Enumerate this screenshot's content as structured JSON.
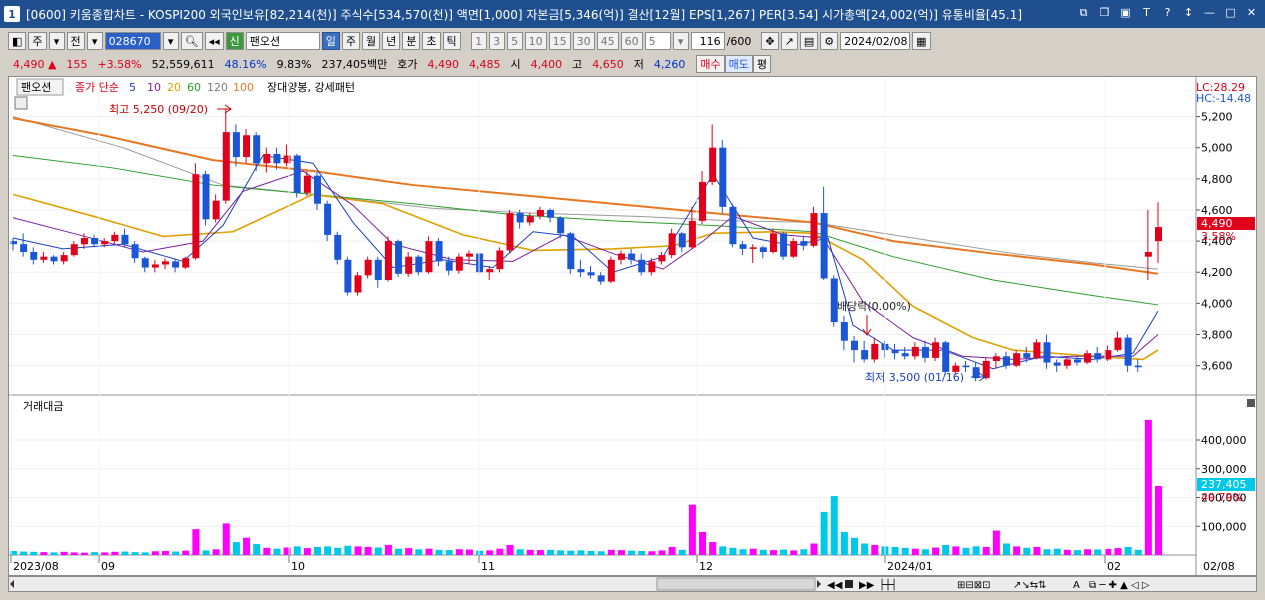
{
  "window": {
    "number": "1",
    "title": "[0600] 키움종합차트 - KOSPI200 외국인보유[82,214(천)] 주식수[534,570(천)] 액면[1,000] 자본금[5,346(억)] 결산[12월] EPS[1,267] PER[3.54] 시가총액[24,002(억)] 유통비율[45.1]"
  },
  "toolbar": {
    "period_main": "주",
    "prev_label": "전",
    "stock_code": "028670",
    "new_badge": "신",
    "stock_name": "팬오션",
    "periods": [
      "일",
      "주",
      "월",
      "년",
      "분",
      "초",
      "틱"
    ],
    "selected_period": "일",
    "intervals": [
      "1",
      "3",
      "5",
      "10",
      "15",
      "30",
      "45",
      "60"
    ],
    "interval_value": "5",
    "count": "116",
    "count_total": "/600",
    "date": "2024/02/08"
  },
  "quote": {
    "price": "4,490",
    "arrow": "▲",
    "change": "155",
    "change_pct": "+3.58%",
    "volume": "52,559,611",
    "vol_ratio": "48.16%",
    "turnover": "9.83%",
    "amount": "237,405백만",
    "bid_label": "호가",
    "bid1": "4,490",
    "bid2": "4,485",
    "open_label": "시",
    "open": "4,400",
    "high_label": "고",
    "high": "4,650",
    "low_label": "저",
    "low": "4,260",
    "buy_label": "매수",
    "sell_label": "매도",
    "eval_label": "평"
  },
  "legend": {
    "stock_name": "팬오션",
    "ma_title": "종가 단순",
    "ma_periods": [
      "5",
      "10",
      "20",
      "60",
      "120",
      "100"
    ],
    "ma_colors": [
      "#1a3fc4",
      "#7b1fa2",
      "#e0a000",
      "#2e9e2e",
      "#7f7f7f",
      "#e87722"
    ],
    "pattern_label": "장대양봉, 강세패턴",
    "lc_label": "LC:28.29",
    "hc_label": "HC:-14.48",
    "volume_title": "거래대금"
  },
  "annotations": {
    "high_marker": "최고 5,250 (09/20)",
    "low_marker": "최저 3,500 (01/16)",
    "ex_marker": "배당락(0.00%)"
  },
  "price_axis": {
    "ticks": [
      "5,200",
      "5,000",
      "4,800",
      "4,600",
      "4,400",
      "4,200",
      "4,000",
      "3,800",
      "3,600"
    ],
    "current": "4,490",
    "current_pct": "3.58%"
  },
  "volume_axis": {
    "ticks": [
      "400,000",
      "300,000",
      "200,000",
      "100,000"
    ],
    "current": "237,405",
    "current_pct": "49.79%"
  },
  "x_axis": [
    "2023/08",
    "09",
    "10",
    "11",
    "12",
    "2024/01",
    "02",
    "02/08"
  ],
  "colors": {
    "up": "#e0001b",
    "down": "#1a56d6",
    "vol_up": "#ff00ff",
    "vol_down": "#00c8e8",
    "title_bg": "#1f4f8f"
  },
  "chart_data": {
    "type": "candlestick",
    "price_ylim": [
      3450,
      5300
    ],
    "volume_ylim": [
      0,
      480000
    ],
    "candles": [
      [
        4400,
        4420,
        4340,
        4380
      ],
      [
        4380,
        4450,
        4300,
        4330
      ],
      [
        4330,
        4360,
        4250,
        4280
      ],
      [
        4280,
        4330,
        4260,
        4300
      ],
      [
        4300,
        4310,
        4250,
        4270
      ],
      [
        4270,
        4330,
        4250,
        4310
      ],
      [
        4310,
        4400,
        4300,
        4380
      ],
      [
        4380,
        4450,
        4350,
        4420
      ],
      [
        4420,
        4440,
        4360,
        4380
      ],
      [
        4380,
        4420,
        4360,
        4400
      ],
      [
        4400,
        4460,
        4380,
        4440
      ],
      [
        4440,
        4480,
        4360,
        4380
      ],
      [
        4380,
        4400,
        4260,
        4290
      ],
      [
        4290,
        4300,
        4200,
        4230
      ],
      [
        4230,
        4280,
        4200,
        4250
      ],
      [
        4250,
        4290,
        4220,
        4270
      ],
      [
        4270,
        4290,
        4200,
        4230
      ],
      [
        4230,
        4300,
        4220,
        4290
      ],
      [
        4290,
        4900,
        4280,
        4830
      ],
      [
        4830,
        4850,
        4500,
        4540
      ],
      [
        4540,
        4700,
        4520,
        4660
      ],
      [
        4660,
        5250,
        4640,
        5100
      ],
      [
        5100,
        5150,
        4880,
        4940
      ],
      [
        4940,
        5120,
        4900,
        5080
      ],
      [
        5080,
        5100,
        4850,
        4900
      ],
      [
        4900,
        5000,
        4840,
        4960
      ],
      [
        4960,
        5000,
        4860,
        4900
      ],
      [
        4900,
        5020,
        4880,
        4950
      ],
      [
        4950,
        4960,
        4680,
        4710
      ],
      [
        4710,
        4850,
        4690,
        4820
      ],
      [
        4820,
        4840,
        4600,
        4640
      ],
      [
        4640,
        4660,
        4400,
        4440
      ],
      [
        4440,
        4460,
        4250,
        4280
      ],
      [
        4280,
        4300,
        4050,
        4070
      ],
      [
        4070,
        4200,
        4050,
        4180
      ],
      [
        4180,
        4300,
        4160,
        4280
      ],
      [
        4280,
        4300,
        4100,
        4150
      ],
      [
        4150,
        4430,
        4140,
        4400
      ],
      [
        4400,
        4410,
        4170,
        4190
      ],
      [
        4190,
        4330,
        4170,
        4300
      ],
      [
        4300,
        4310,
        4180,
        4200
      ],
      [
        4200,
        4430,
        4190,
        4400
      ],
      [
        4400,
        4420,
        4240,
        4270
      ],
      [
        4270,
        4300,
        4180,
        4210
      ],
      [
        4210,
        4320,
        4190,
        4300
      ],
      [
        4300,
        4340,
        4250,
        4320
      ],
      [
        4320,
        4330,
        4180,
        4200
      ],
      [
        4200,
        4240,
        4150,
        4220
      ],
      [
        4220,
        4360,
        4200,
        4340
      ],
      [
        4340,
        4600,
        4320,
        4580
      ],
      [
        4580,
        4600,
        4480,
        4520
      ],
      [
        4520,
        4580,
        4500,
        4560
      ],
      [
        4560,
        4620,
        4540,
        4600
      ],
      [
        4600,
        4610,
        4520,
        4550
      ],
      [
        4550,
        4560,
        4420,
        4450
      ],
      [
        4450,
        4460,
        4190,
        4220
      ],
      [
        4220,
        4280,
        4170,
        4200
      ],
      [
        4200,
        4240,
        4160,
        4180
      ],
      [
        4180,
        4200,
        4120,
        4140
      ],
      [
        4140,
        4300,
        4130,
        4280
      ],
      [
        4280,
        4340,
        4250,
        4320
      ],
      [
        4320,
        4350,
        4250,
        4280
      ],
      [
        4280,
        4320,
        4180,
        4200
      ],
      [
        4200,
        4290,
        4180,
        4270
      ],
      [
        4270,
        4330,
        4250,
        4310
      ],
      [
        4310,
        4480,
        4290,
        4450
      ],
      [
        4450,
        4460,
        4330,
        4360
      ],
      [
        4360,
        4620,
        4350,
        4530
      ],
      [
        4530,
        4850,
        4510,
        4780
      ],
      [
        4780,
        5150,
        4760,
        5000
      ],
      [
        5000,
        5050,
        4580,
        4620
      ],
      [
        4620,
        4640,
        4360,
        4380
      ],
      [
        4380,
        4400,
        4310,
        4350
      ],
      [
        4350,
        4380,
        4260,
        4360
      ],
      [
        4360,
        4370,
        4290,
        4330
      ],
      [
        4330,
        4480,
        4320,
        4450
      ],
      [
        4450,
        4460,
        4280,
        4300
      ],
      [
        4300,
        4420,
        4290,
        4400
      ],
      [
        4400,
        4430,
        4340,
        4370
      ],
      [
        4370,
        4620,
        4360,
        4580
      ],
      [
        4580,
        4750,
        4150,
        4160
      ],
      [
        4160,
        4180,
        3850,
        3880
      ],
      [
        3880,
        3920,
        3700,
        3760
      ],
      [
        3760,
        3790,
        3620,
        3700
      ],
      [
        3700,
        3760,
        3620,
        3640
      ],
      [
        3640,
        3780,
        3620,
        3740
      ],
      [
        3740,
        3760,
        3650,
        3700
      ],
      [
        3700,
        3740,
        3640,
        3680
      ],
      [
        3680,
        3720,
        3640,
        3660
      ],
      [
        3660,
        3750,
        3640,
        3720
      ],
      [
        3720,
        3760,
        3620,
        3650
      ],
      [
        3650,
        3780,
        3630,
        3750
      ],
      [
        3750,
        3760,
        3540,
        3560
      ],
      [
        3560,
        3620,
        3540,
        3600
      ],
      [
        3600,
        3630,
        3560,
        3590
      ],
      [
        3590,
        3620,
        3500,
        3520
      ],
      [
        3520,
        3650,
        3510,
        3630
      ],
      [
        3630,
        3680,
        3580,
        3660
      ],
      [
        3660,
        3690,
        3580,
        3600
      ],
      [
        3600,
        3700,
        3590,
        3680
      ],
      [
        3680,
        3720,
        3620,
        3650
      ],
      [
        3650,
        3770,
        3640,
        3750
      ],
      [
        3750,
        3800,
        3580,
        3620
      ],
      [
        3620,
        3640,
        3560,
        3600
      ],
      [
        3600,
        3660,
        3580,
        3640
      ],
      [
        3640,
        3660,
        3600,
        3620
      ],
      [
        3620,
        3700,
        3610,
        3680
      ],
      [
        3680,
        3720,
        3620,
        3640
      ],
      [
        3640,
        3730,
        3630,
        3700
      ],
      [
        3700,
        3820,
        3690,
        3780
      ],
      [
        3780,
        3800,
        3560,
        3600
      ],
      [
        3600,
        3640,
        3560,
        3590
      ],
      [
        4300,
        4600,
        4150,
        4330
      ],
      [
        4400,
        4650,
        4260,
        4490
      ]
    ],
    "volumes": [
      14000,
      12000,
      11000,
      10000,
      9000,
      11000,
      9000,
      8000,
      10000,
      9000,
      11000,
      12000,
      10000,
      9000,
      13000,
      14000,
      12000,
      15000,
      90000,
      16000,
      20000,
      110000,
      45000,
      60000,
      38000,
      25000,
      22000,
      26000,
      30000,
      24000,
      28000,
      30000,
      25000,
      32000,
      30000,
      28000,
      26000,
      35000,
      22000,
      24000,
      20000,
      22000,
      18000,
      17000,
      20000,
      19000,
      15000,
      16000,
      22000,
      35000,
      20000,
      18000,
      17000,
      18000,
      16000,
      15000,
      16000,
      14000,
      13000,
      18000,
      17000,
      15000,
      14000,
      13000,
      16000,
      28000,
      18000,
      175000,
      80000,
      45000,
      30000,
      25000,
      20000,
      22000,
      18000,
      17000,
      19000,
      16000,
      20000,
      40000,
      150000,
      205000,
      80000,
      60000,
      40000,
      35000,
      30000,
      28000,
      25000,
      22000,
      20000,
      26000,
      35000,
      30000,
      25000,
      30000,
      28000,
      85000,
      40000,
      30000,
      25000,
      28000,
      20000,
      22000,
      18000,
      17000,
      20000,
      19000,
      21000,
      24000,
      28000,
      18000,
      470000,
      240000
    ],
    "ma": {
      "ma120": [
        [
          0,
          5200
        ],
        [
          110,
          5000
        ],
        [
          210,
          4760
        ],
        [
          300,
          4700
        ],
        [
          420,
          4610
        ],
        [
          520,
          4580
        ],
        [
          620,
          4560
        ],
        [
          720,
          4530
        ],
        [
          800,
          4520
        ],
        [
          900,
          4420
        ],
        [
          1000,
          4320
        ],
        [
          1080,
          4260
        ],
        [
          1145,
          4220
        ]
      ],
      "ma100": [
        [
          0,
          5190
        ],
        [
          90,
          5080
        ],
        [
          200,
          4920
        ],
        [
          300,
          4850
        ],
        [
          400,
          4760
        ],
        [
          500,
          4700
        ],
        [
          600,
          4640
        ],
        [
          700,
          4580
        ],
        [
          800,
          4520
        ],
        [
          880,
          4400
        ],
        [
          980,
          4320
        ],
        [
          1080,
          4250
        ],
        [
          1145,
          4190
        ]
      ],
      "ma60": [
        [
          0,
          4950
        ],
        [
          100,
          4870
        ],
        [
          200,
          4760
        ],
        [
          300,
          4700
        ],
        [
          400,
          4640
        ],
        [
          500,
          4570
        ],
        [
          600,
          4530
        ],
        [
          700,
          4500
        ],
        [
          800,
          4460
        ],
        [
          880,
          4300
        ],
        [
          980,
          4150
        ],
        [
          1080,
          4050
        ],
        [
          1145,
          3990
        ]
      ],
      "ma20": [
        [
          0,
          4700
        ],
        [
          80,
          4560
        ],
        [
          150,
          4430
        ],
        [
          220,
          4460
        ],
        [
          300,
          4700
        ],
        [
          370,
          4640
        ],
        [
          450,
          4440
        ],
        [
          520,
          4340
        ],
        [
          600,
          4350
        ],
        [
          660,
          4370
        ],
        [
          700,
          4450
        ],
        [
          760,
          4460
        ],
        [
          800,
          4450
        ],
        [
          850,
          4280
        ],
        [
          900,
          3980
        ],
        [
          960,
          3780
        ],
        [
          1000,
          3700
        ],
        [
          1080,
          3660
        ],
        [
          1130,
          3640
        ],
        [
          1145,
          3700
        ]
      ],
      "ma10": [
        [
          0,
          4550
        ],
        [
          60,
          4450
        ],
        [
          130,
          4330
        ],
        [
          190,
          4400
        ],
        [
          230,
          4720
        ],
        [
          290,
          4850
        ],
        [
          340,
          4630
        ],
        [
          380,
          4380
        ],
        [
          440,
          4280
        ],
        [
          500,
          4270
        ],
        [
          550,
          4440
        ],
        [
          600,
          4320
        ],
        [
          650,
          4220
        ],
        [
          690,
          4400
        ],
        [
          720,
          4560
        ],
        [
          770,
          4440
        ],
        [
          810,
          4420
        ],
        [
          850,
          4010
        ],
        [
          900,
          3780
        ],
        [
          950,
          3660
        ],
        [
          1000,
          3640
        ],
        [
          1060,
          3660
        ],
        [
          1120,
          3660
        ],
        [
          1145,
          3800
        ]
      ],
      "ma5": [
        [
          0,
          4420
        ],
        [
          50,
          4350
        ],
        [
          110,
          4380
        ],
        [
          170,
          4270
        ],
        [
          210,
          4500
        ],
        [
          250,
          4950
        ],
        [
          300,
          4900
        ],
        [
          340,
          4520
        ],
        [
          380,
          4230
        ],
        [
          430,
          4280
        ],
        [
          480,
          4230
        ],
        [
          520,
          4460
        ],
        [
          560,
          4430
        ],
        [
          600,
          4200
        ],
        [
          650,
          4300
        ],
        [
          700,
          4830
        ],
        [
          740,
          4420
        ],
        [
          780,
          4370
        ],
        [
          815,
          4420
        ],
        [
          840,
          3860
        ],
        [
          880,
          3700
        ],
        [
          930,
          3700
        ],
        [
          980,
          3580
        ],
        [
          1030,
          3660
        ],
        [
          1080,
          3640
        ],
        [
          1120,
          3680
        ],
        [
          1145,
          3950
        ]
      ]
    }
  }
}
